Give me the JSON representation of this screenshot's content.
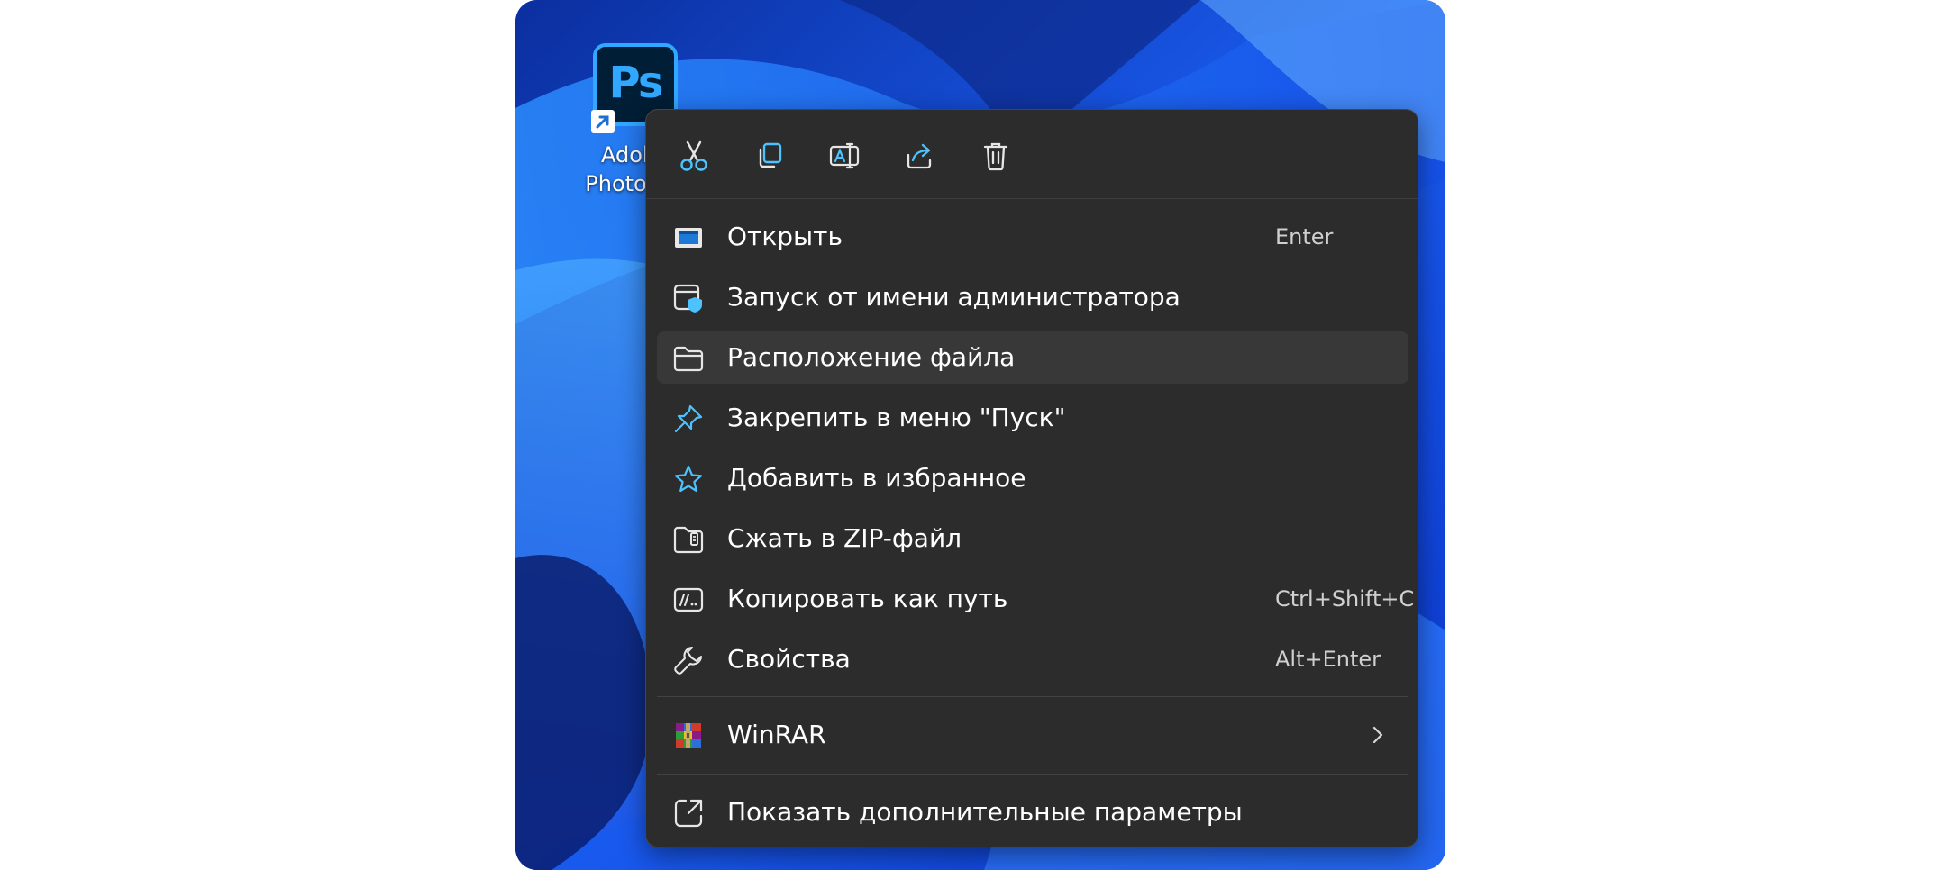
{
  "desktop": {
    "shortcut": {
      "icon_text": "Ps",
      "label_line1": "Adobe",
      "label_line2": "Photosh.."
    }
  },
  "context_menu": {
    "toolbar": [
      {
        "name": "cut",
        "icon": "scissors-icon"
      },
      {
        "name": "copy",
        "icon": "copy-icon"
      },
      {
        "name": "rename",
        "icon": "rename-icon"
      },
      {
        "name": "share",
        "icon": "share-icon"
      },
      {
        "name": "delete",
        "icon": "trash-icon"
      }
    ],
    "items": [
      {
        "label": "Открыть",
        "accel": "Enter",
        "icon": "open-app-icon"
      },
      {
        "label": "Запуск от имени администратора",
        "accel": "",
        "icon": "admin-shield-icon"
      },
      {
        "label": "Расположение файла",
        "accel": "",
        "icon": "folder-icon",
        "highlighted": true
      },
      {
        "label": "Закрепить в меню \"Пуск\"",
        "accel": "",
        "icon": "pin-icon"
      },
      {
        "label": "Добавить в избранное",
        "accel": "",
        "icon": "star-icon"
      },
      {
        "label": "Сжать в ZIP-файл",
        "accel": "",
        "icon": "zip-folder-icon"
      },
      {
        "label": "Копировать как путь",
        "accel": "Ctrl+Shift+C",
        "icon": "copy-path-icon"
      },
      {
        "label": "Свойства",
        "accel": "Alt+Enter",
        "icon": "wrench-icon"
      }
    ],
    "winrar": {
      "label": "WinRAR",
      "icon": "winrar-icon",
      "submenu": true
    },
    "more": {
      "label": "Показать дополнительные параметры",
      "icon": "show-more-icon"
    }
  },
  "colors": {
    "menu_bg": "#2c2c2c",
    "hover_bg": "#383838",
    "accent": "#4cc2ff",
    "wallpaper": "#1747d8"
  }
}
